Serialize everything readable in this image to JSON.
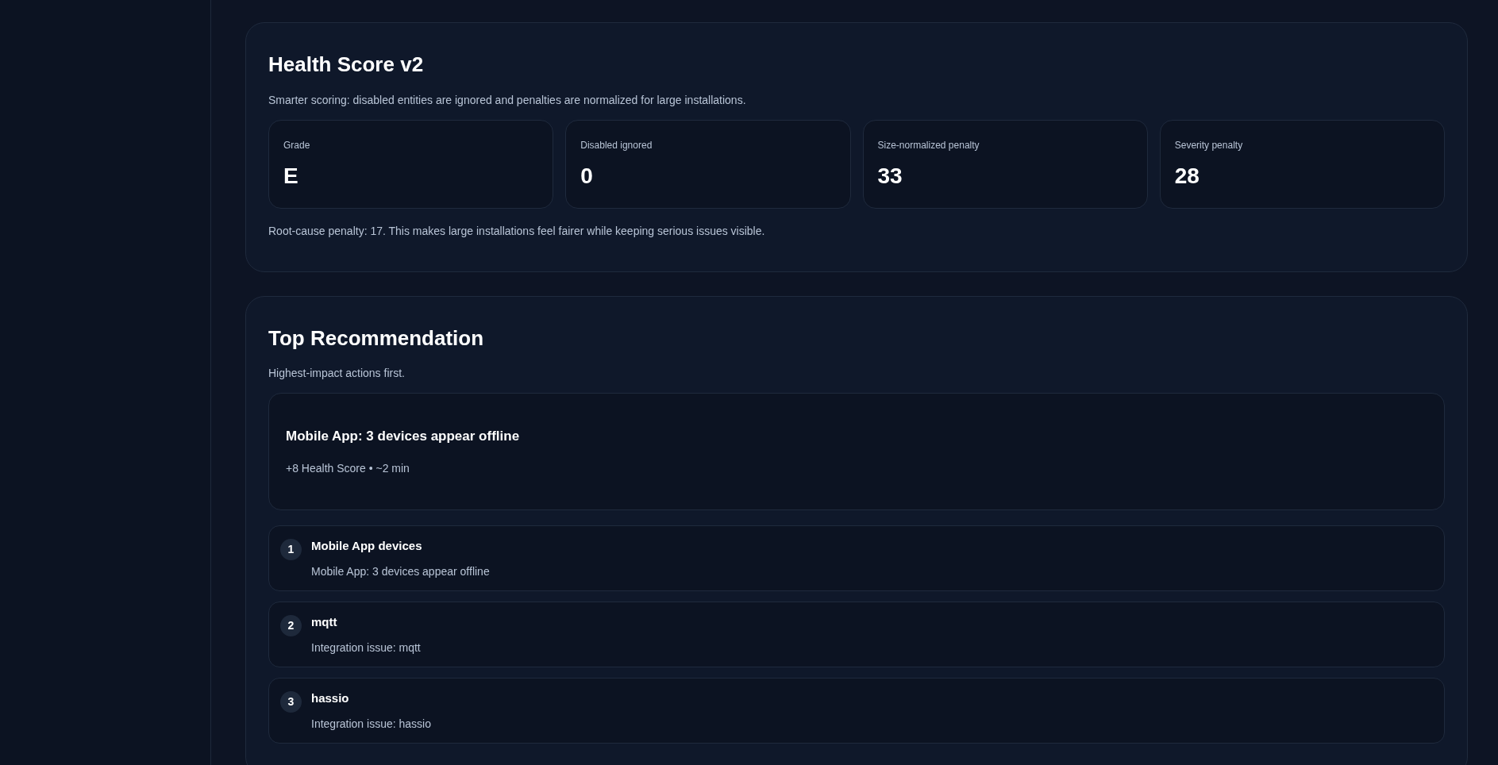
{
  "health_score": {
    "title": "Health Score v2",
    "description": "Smarter scoring: disabled entities are ignored and penalties are normalized for large installations.",
    "stats": [
      {
        "label": "Grade",
        "value": "E"
      },
      {
        "label": "Disabled ignored",
        "value": "0"
      },
      {
        "label": "Size-normalized penalty",
        "value": "33"
      },
      {
        "label": "Severity penalty",
        "value": "28"
      }
    ],
    "note": "Root-cause penalty: 17. This makes large installations feel fairer while keeping serious issues visible."
  },
  "top_recommendation": {
    "title": "Top Recommendation",
    "description": "Highest-impact actions first.",
    "highlight": {
      "title": "Mobile App: 3 devices appear offline",
      "meta": "+8 Health Score • ~2 min"
    },
    "items": [
      {
        "number": "1",
        "title": "Mobile App devices",
        "detail": "Mobile App: 3 devices appear offline"
      },
      {
        "number": "2",
        "title": "mqtt",
        "detail": "Integration issue: mqtt"
      },
      {
        "number": "3",
        "title": "hassio",
        "detail": "Integration issue: hassio"
      }
    ]
  }
}
